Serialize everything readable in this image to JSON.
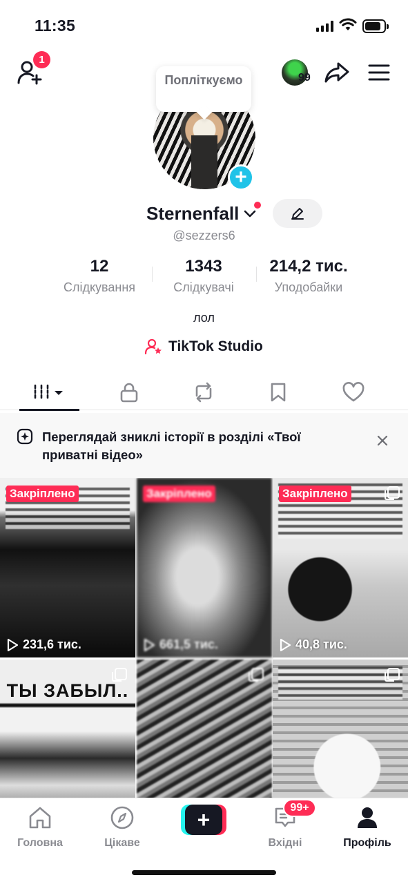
{
  "status_bar": {
    "time": "11:35"
  },
  "header": {
    "notification_count": "1",
    "friends_count": "99"
  },
  "tooltip": {
    "text": "Попліткуємо"
  },
  "profile": {
    "display_name": "Sternenfall",
    "username": "@sezzers6",
    "bio": "лол",
    "link_label": "TikTok Studio"
  },
  "stats": [
    {
      "value": "12",
      "label": "Слідкування"
    },
    {
      "value": "1343",
      "label": "Слідкувачі"
    },
    {
      "value": "214,2 тис.",
      "label": "Уподобайки"
    }
  ],
  "tabs": [
    {
      "icon": "grid-icon",
      "active": true
    },
    {
      "icon": "lock-icon",
      "active": false
    },
    {
      "icon": "repost-icon",
      "active": false
    },
    {
      "icon": "bookmark-icon",
      "active": false
    },
    {
      "icon": "heart-icon",
      "active": false
    }
  ],
  "banner": {
    "text": "Переглядай зниклі історії в розділі «Твої приватні відео»"
  },
  "videos": [
    {
      "pinned_label": "Закріплено",
      "views": "231,6 тис."
    },
    {
      "pinned_label": "Закріплено",
      "views": "661,5 тис."
    },
    {
      "pinned_label": "Закріплено",
      "views": "40,8 тис."
    },
    {
      "caption": "ТЫ ЗАБЫЛ.."
    },
    {},
    {}
  ],
  "bottom_nav": {
    "home": "Головна",
    "discover": "Цікаве",
    "create": "+",
    "inbox": "Вхідні",
    "inbox_badge": "99+",
    "profile": "Профіль"
  },
  "colors": {
    "accent": "#fe2c55",
    "cyan": "#25f4ee",
    "text": "#161823",
    "muted": "#8a8b91"
  }
}
